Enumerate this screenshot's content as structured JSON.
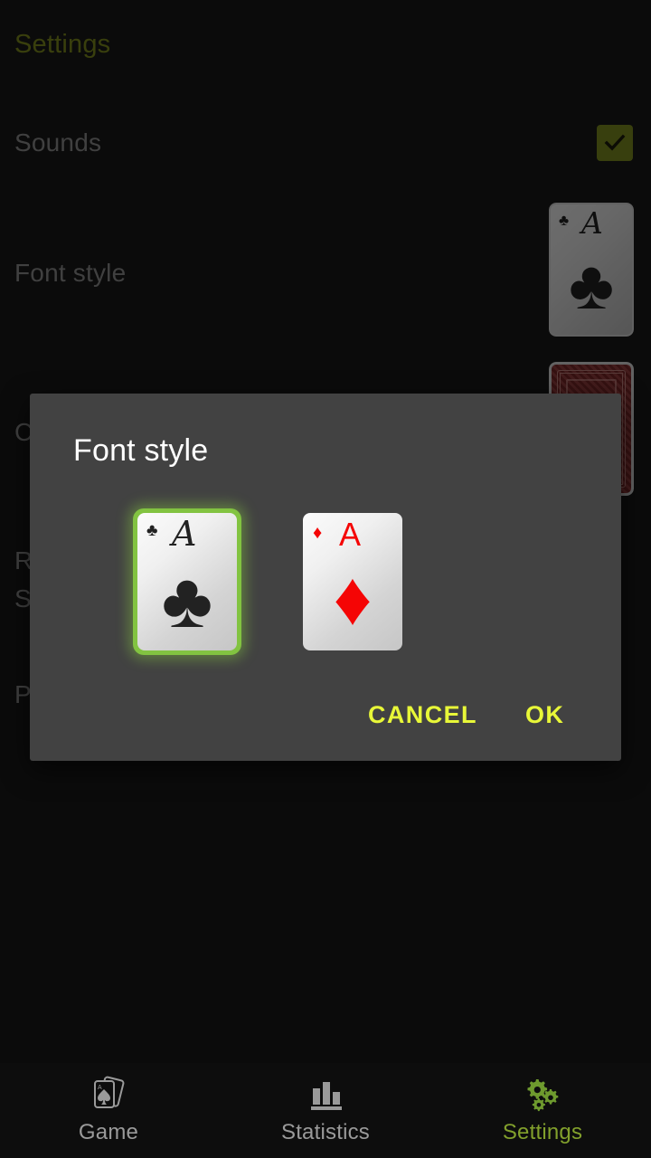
{
  "app": {
    "background_color": "#191919",
    "accent_color": "#82c341",
    "dialog_color": "#424242"
  },
  "settings_page": {
    "header": "Settings",
    "rows": [
      {
        "label": "Sounds",
        "control": "checkbox",
        "checked": true
      },
      {
        "label": "Font style",
        "control": "card-preview"
      },
      {
        "label": "C",
        "control": "card-back-preview"
      },
      {
        "label": "R",
        "control": "none"
      },
      {
        "label": "S",
        "control": "none"
      },
      {
        "label": "P",
        "control": "none"
      }
    ],
    "checkbox_color": "#7d8c1f",
    "preview_cards": [
      {
        "rank": "A",
        "suit": "club",
        "suit_glyph": "♣",
        "style": "script",
        "color": "#222222"
      },
      {
        "type": "card-back",
        "color": "#8c2f2f"
      }
    ]
  },
  "dialog": {
    "title": "Font style",
    "options": [
      {
        "id": "font-style-script",
        "rank": "A",
        "suit_glyph": "♣",
        "suit_name": "club",
        "color": "#222222",
        "style": "script",
        "selected": true
      },
      {
        "id": "font-style-plain",
        "rank": "A",
        "suit_glyph": "♦",
        "suit_name": "diamond",
        "color": "#f50505",
        "style": "plain",
        "selected": false
      }
    ],
    "cancel_label": "CANCEL",
    "ok_label": "OK",
    "button_color": "#e8f738"
  },
  "bottom_nav": {
    "items": [
      {
        "label": "Game",
        "icon": "playing-cards-icon",
        "active": false
      },
      {
        "label": "Statistics",
        "icon": "bar-chart-icon",
        "active": false
      },
      {
        "label": "Settings",
        "icon": "gears-icon",
        "active": true
      }
    ],
    "active_color": "#82a02c",
    "inactive_color": "#9a9a9a"
  }
}
